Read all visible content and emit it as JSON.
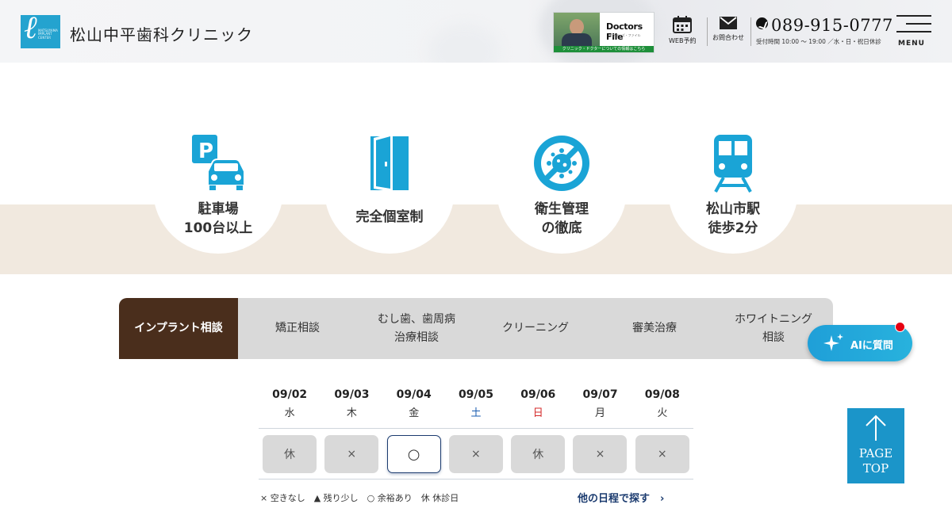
{
  "header": {
    "logo_small_text": "MATSUYAMA IMPLANT CENTER",
    "site_title": "松山中平歯科クリニック",
    "doctors_file": {
      "title": "Doctors File",
      "subtitle": "ドクターズ・ファイル",
      "bar_text": "クリニック・ドクターについての情報はこちら"
    },
    "web_reserve_label": "WEB予約",
    "contact_label": "お問合わせ",
    "phone_number": "089-915-0777",
    "hours": "受付時間 10:00 ～ 19:00 ／水・日・祝日休診",
    "menu_label": "MENU"
  },
  "features": [
    {
      "line1": "駐車場",
      "line2": "100台以上",
      "icon": "parking-car-icon"
    },
    {
      "line1": "完全個室制",
      "line2": "",
      "icon": "door-icon"
    },
    {
      "line1": "衛生管理",
      "line2": "の徹底",
      "icon": "no-germs-icon"
    },
    {
      "line1": "松山市駅",
      "line2": "徒歩2分",
      "icon": "train-icon"
    }
  ],
  "schedule": {
    "tabs": [
      {
        "label": "インプラント相談",
        "active": true
      },
      {
        "label": "矯正相談",
        "active": false
      },
      {
        "label": "むし歯、歯周病治療相談",
        "active": false
      },
      {
        "label": "クリーニング",
        "active": false
      },
      {
        "label": "審美治療",
        "active": false
      },
      {
        "label": "ホワイトニング相談",
        "active": false
      }
    ],
    "days": [
      {
        "date": "09/02",
        "weekday": "水",
        "slot": "休"
      },
      {
        "date": "09/03",
        "weekday": "木",
        "slot": "×"
      },
      {
        "date": "09/04",
        "weekday": "金",
        "slot": "○"
      },
      {
        "date": "09/05",
        "weekday": "土",
        "slot": "×"
      },
      {
        "date": "09/06",
        "weekday": "日",
        "slot": "休"
      },
      {
        "date": "09/07",
        "weekday": "月",
        "slot": "×"
      },
      {
        "date": "09/08",
        "weekday": "火",
        "slot": "×"
      }
    ],
    "legend": "× 空きなし　▲ 残り少し　○ 余裕あり　休 休診日",
    "more_link": "他の日程で探す　›"
  },
  "ai_button_label": "AIに質問",
  "page_top_label_1": "PAGE",
  "page_top_label_2": "TOP",
  "colors": {
    "accent_blue": "#1b95c9",
    "icon_blue": "#1aa4d6",
    "active_tab": "#4a2e1c",
    "band_beige": "#f1e9df",
    "navy": "#1b3b6f"
  }
}
